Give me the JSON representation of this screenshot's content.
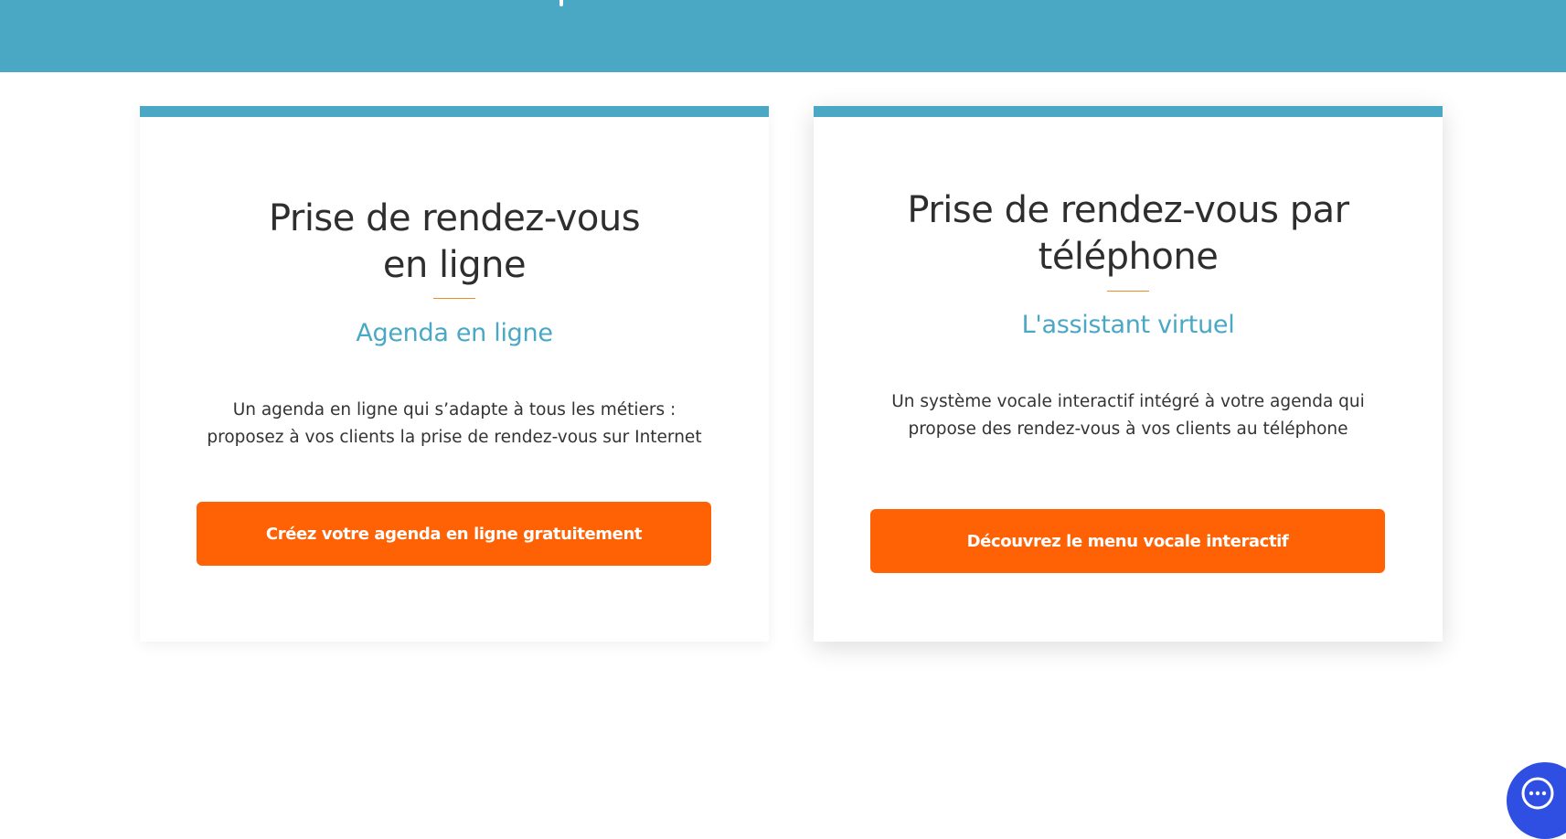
{
  "cards": [
    {
      "title_line1": "Prise de rendez-vous",
      "title_line2": "en ligne",
      "subtitle": "Agenda en ligne",
      "desc_line1": "Un agenda en ligne qui s’adapte à tous les métiers :",
      "desc_line2": "proposez à vos clients la prise de rendez-vous sur Internet",
      "button_label": "Créez votre agenda en ligne gratuitement"
    },
    {
      "title_line1": "Prise de rendez-vous par",
      "title_line2": "téléphone",
      "subtitle": "L'assistant virtuel",
      "desc_line1": "Un système vocale interactif intégré à votre agenda qui",
      "desc_line2": "propose des rendez-vous à vos clients au téléphone",
      "button_label": "Découvrez le menu vocale interactif"
    }
  ],
  "colors": {
    "banner": "#4aa8c5",
    "accent": "#4aa8c5",
    "cta": "#ff6205",
    "divider": "#f28a2a",
    "chat": "#2f4fe3"
  },
  "chat_widget": {
    "icon": "chat-bubble-icon"
  }
}
